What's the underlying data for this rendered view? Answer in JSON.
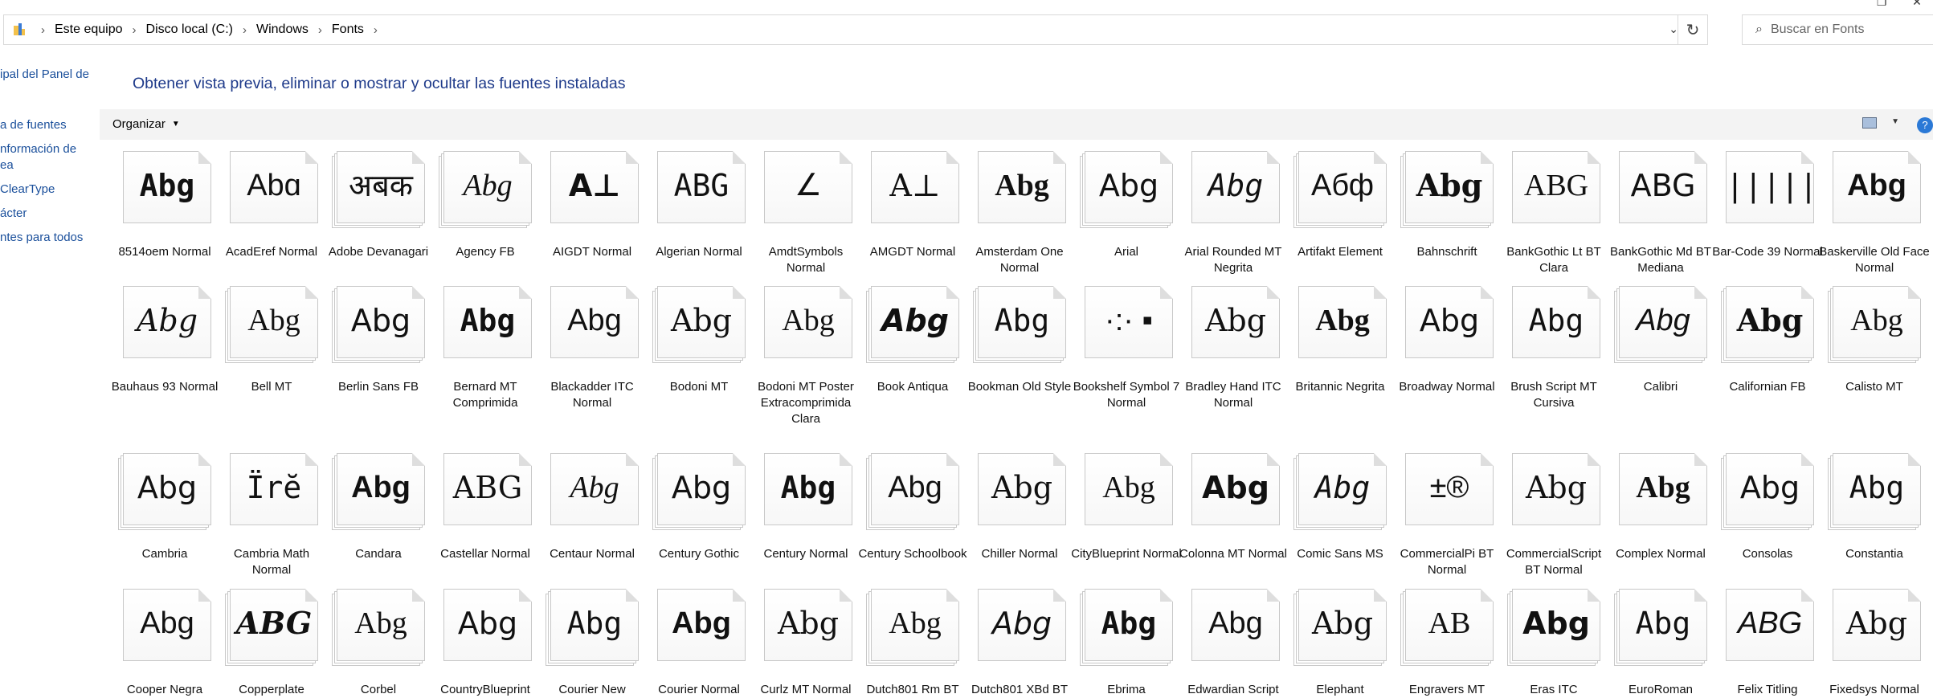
{
  "window": {
    "restore_glyph": "❐",
    "close_glyph": "✕"
  },
  "address": {
    "crumbs": [
      "Este equipo",
      "Disco local (C:)",
      "Windows",
      "Fonts"
    ],
    "separator": "›",
    "dropdown_glyph": "⌄",
    "refresh_glyph": "↻"
  },
  "search": {
    "placeholder": "Buscar en Fonts",
    "icon": "search-icon"
  },
  "leftnav": {
    "items": [
      "ipal del Panel de",
      "a de fuentes",
      "nformación de",
      "ea",
      "ClearType",
      "ácter",
      "ntes para todos"
    ]
  },
  "page": {
    "title": "Obtener vista previa, eliminar o mostrar y ocultar las fuentes instaladas"
  },
  "toolbar": {
    "organize_label": "Organizar",
    "help_label": "?"
  },
  "fonts": [
    {
      "name": "8514oem Normal",
      "sample": "Abg",
      "stack": 1
    },
    {
      "name": "AcadEref Normal",
      "sample": "Abɑ",
      "stack": 1
    },
    {
      "name": "Adobe Devanagari",
      "sample": "अबक",
      "stack": 3
    },
    {
      "name": "Agency FB",
      "sample": "Abg",
      "stack": 3
    },
    {
      "name": "AIGDT Normal",
      "sample": "A⊥",
      "stack": 1
    },
    {
      "name": "Algerian Normal",
      "sample": "ABG",
      "stack": 1
    },
    {
      "name": "AmdtSymbols Normal",
      "sample": "∠",
      "stack": 1
    },
    {
      "name": "AMGDT Normal",
      "sample": "A⊥",
      "stack": 1
    },
    {
      "name": "Amsterdam One Normal",
      "sample": "Abg",
      "stack": 1
    },
    {
      "name": "Arial",
      "sample": "Abg",
      "stack": 3
    },
    {
      "name": "Arial Rounded MT Negrita",
      "sample": "Abg",
      "stack": 1
    },
    {
      "name": "Artifakt Element",
      "sample": "Абф",
      "stack": 3
    },
    {
      "name": "Bahnschrift",
      "sample": "Abg",
      "stack": 3
    },
    {
      "name": "BankGothic Lt BT Clara",
      "sample": "ABG",
      "stack": 1
    },
    {
      "name": "BankGothic Md BT Mediana",
      "sample": "ABG",
      "stack": 1
    },
    {
      "name": "Bar-Code 39 Normal",
      "sample": "|||||||||",
      "stack": 1
    },
    {
      "name": "Baskerville Old Face Normal",
      "sample": "Abg",
      "stack": 1
    },
    {
      "name": "Bauhaus 93 Normal",
      "sample": "Abg",
      "stack": 1
    },
    {
      "name": "Bell MT",
      "sample": "Abg",
      "stack": 3
    },
    {
      "name": "Berlin Sans FB",
      "sample": "Abg",
      "stack": 3
    },
    {
      "name": "Bernard MT Comprimida",
      "sample": "Abg",
      "stack": 1
    },
    {
      "name": "Blackadder ITC Normal",
      "sample": "Abg",
      "stack": 1
    },
    {
      "name": "Bodoni MT",
      "sample": "Abg",
      "stack": 3
    },
    {
      "name": "Bodoni MT Poster Extracomprimida Clara",
      "sample": "Abg",
      "stack": 1
    },
    {
      "name": "Book Antiqua",
      "sample": "Abg",
      "stack": 3
    },
    {
      "name": "Bookman Old Style",
      "sample": "Abg",
      "stack": 3
    },
    {
      "name": "Bookshelf Symbol 7 Normal",
      "sample": "·:· ▪",
      "stack": 1
    },
    {
      "name": "Bradley Hand ITC Normal",
      "sample": "Abg",
      "stack": 1
    },
    {
      "name": "Britannic Negrita",
      "sample": "Abg",
      "stack": 1
    },
    {
      "name": "Broadway Normal",
      "sample": "Abg",
      "stack": 1
    },
    {
      "name": "Brush Script MT Cursiva",
      "sample": "Abg",
      "stack": 1
    },
    {
      "name": "Calibri",
      "sample": "Abg",
      "stack": 3
    },
    {
      "name": "Californian FB",
      "sample": "Abg",
      "stack": 3
    },
    {
      "name": "Calisto MT",
      "sample": "Abg",
      "stack": 3
    },
    {
      "name": "Cambria",
      "sample": "Abg",
      "stack": 3
    },
    {
      "name": "Cambria Math Normal",
      "sample": "Ïrĕ",
      "stack": 1
    },
    {
      "name": "Candara",
      "sample": "Abg",
      "stack": 3
    },
    {
      "name": "Castellar Normal",
      "sample": "ABG",
      "stack": 1
    },
    {
      "name": "Centaur Normal",
      "sample": "Abg",
      "stack": 1
    },
    {
      "name": "Century Gothic",
      "sample": "Abg",
      "stack": 3
    },
    {
      "name": "Century Normal",
      "sample": "Abg",
      "stack": 1
    },
    {
      "name": "Century Schoolbook",
      "sample": "Abg",
      "stack": 3
    },
    {
      "name": "Chiller Normal",
      "sample": "Abg",
      "stack": 1
    },
    {
      "name": "CityBlueprint Normal",
      "sample": "Abg",
      "stack": 1
    },
    {
      "name": "Colonna MT Normal",
      "sample": "Abg",
      "stack": 1
    },
    {
      "name": "Comic Sans MS",
      "sample": "Abg",
      "stack": 3
    },
    {
      "name": "CommercialPi BT Normal",
      "sample": "±®",
      "stack": 1
    },
    {
      "name": "CommercialScript BT Normal",
      "sample": "Abg",
      "stack": 1
    },
    {
      "name": "Complex Normal",
      "sample": "Abg",
      "stack": 1
    },
    {
      "name": "Consolas",
      "sample": "Abg",
      "stack": 3
    },
    {
      "name": "Constantia",
      "sample": "Abg",
      "stack": 3
    },
    {
      "name": "Cooper Negra",
      "sample": "Abg",
      "stack": 1
    },
    {
      "name": "Copperplate",
      "sample": "ABG",
      "stack": 3
    },
    {
      "name": "Corbel",
      "sample": "Abg",
      "stack": 3
    },
    {
      "name": "CountryBlueprint",
      "sample": "Abg",
      "stack": 1
    },
    {
      "name": "Courier New",
      "sample": "Abg",
      "stack": 3
    },
    {
      "name": "Courier Normal",
      "sample": "Abg",
      "stack": 1
    },
    {
      "name": "Curlz MT Normal",
      "sample": "Abg",
      "stack": 1
    },
    {
      "name": "Dutch801 Rm BT",
      "sample": "Abg",
      "stack": 3
    },
    {
      "name": "Dutch801 XBd BT",
      "sample": "Abg",
      "stack": 1
    },
    {
      "name": "Ebrima",
      "sample": "Abg",
      "stack": 3
    },
    {
      "name": "Edwardian Script",
      "sample": "Abg",
      "stack": 1
    },
    {
      "name": "Elephant",
      "sample": "Abg",
      "stack": 3
    },
    {
      "name": "Engravers MT",
      "sample": "AB",
      "stack": 3
    },
    {
      "name": "Eras ITC",
      "sample": "Abg",
      "stack": 3
    },
    {
      "name": "EuroRoman",
      "sample": "Abg",
      "stack": 3
    },
    {
      "name": "Felix Titling",
      "sample": "ABG",
      "stack": 1
    },
    {
      "name": "Fixedsys Normal",
      "sample": "Abg",
      "stack": 1
    }
  ]
}
